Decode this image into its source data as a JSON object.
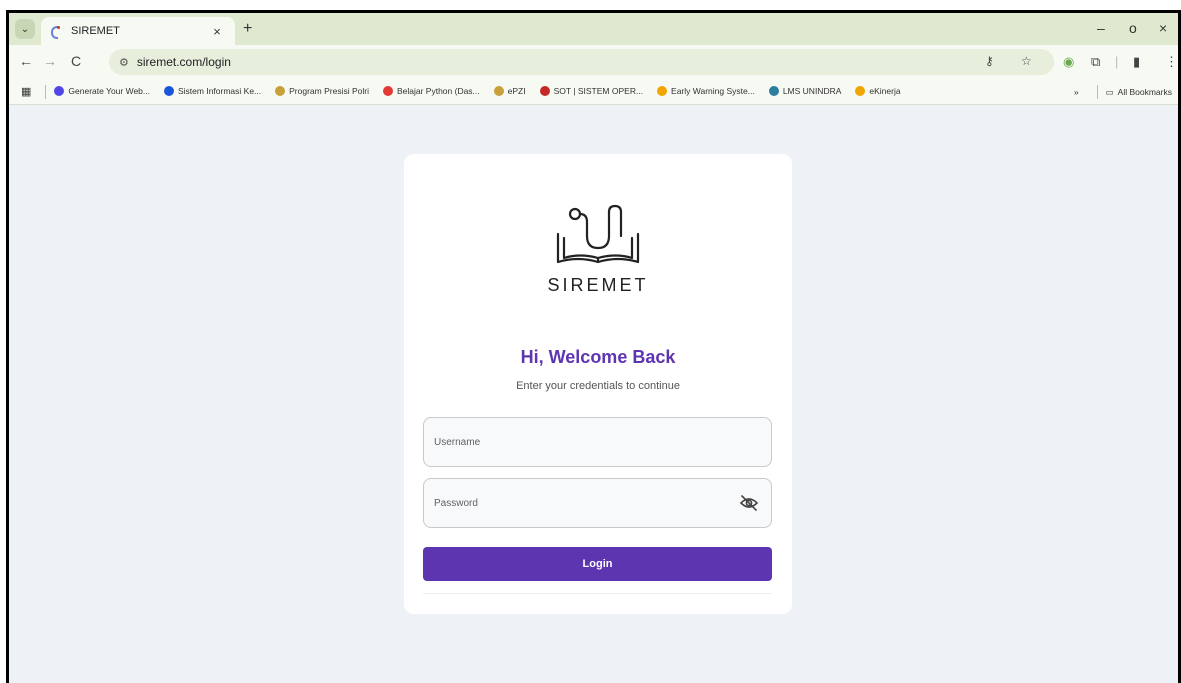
{
  "browser": {
    "tab_title": "SIREMET",
    "tab_close": "×",
    "new_tab": "+",
    "url": "siremet.com/login",
    "window_controls": {
      "minimize": "–",
      "restore": "o",
      "close": "×"
    }
  },
  "bookmarks": {
    "items": [
      {
        "label": "Generate Your Web...",
        "color": "#4f46e5"
      },
      {
        "label": "Sistem Informasi Ke...",
        "color": "#1a56db"
      },
      {
        "label": "Program Presisi Polri",
        "color": "#c7a03a"
      },
      {
        "label": "Belajar Python (Das...",
        "color": "#e53935"
      },
      {
        "label": "ePZI",
        "color": "#c7a03a"
      },
      {
        "label": "SOT | SISTEM OPER...",
        "color": "#c62828"
      },
      {
        "label": "Early Warning Syste...",
        "color": "#f0a500"
      },
      {
        "label": "LMS UNINDRA",
        "color": "#2e7d9e"
      },
      {
        "label": "eKinerja",
        "color": "#f0a500"
      }
    ],
    "more": "»",
    "all_bookmarks": "All Bookmarks"
  },
  "login": {
    "brand": "SIREMET",
    "heading": "Hi, Welcome Back",
    "subheading": "Enter your credentials to continue",
    "username_placeholder": "Username",
    "password_placeholder": "Password",
    "login_label": "Login"
  },
  "colors": {
    "primary": "#5e35b1",
    "page_bg": "#eef1f5",
    "tabstrip_bg": "#dfe9cf"
  }
}
